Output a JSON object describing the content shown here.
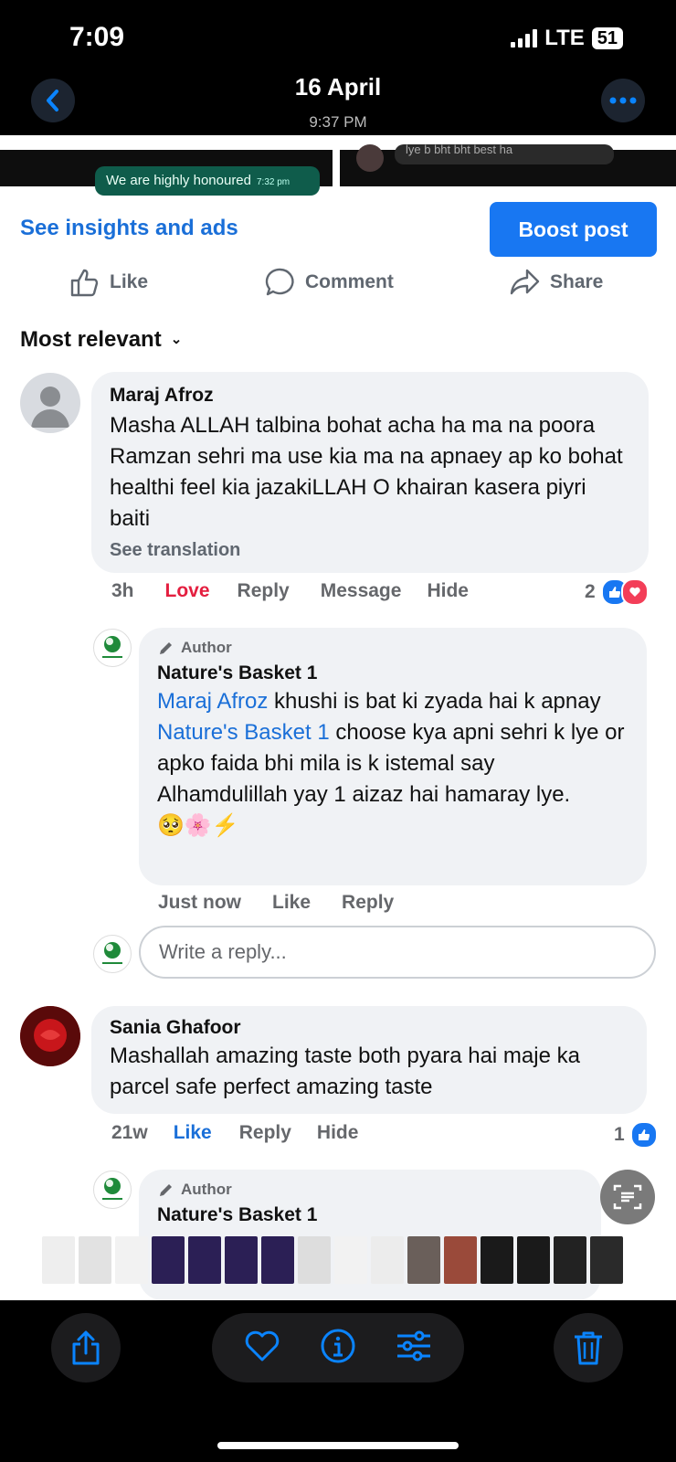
{
  "status_bar": {
    "time": "7:09",
    "network": "LTE",
    "battery": "51"
  },
  "header": {
    "date": "16 April",
    "time": "9:37 PM"
  },
  "preview": {
    "message": "We are highly honoured",
    "message_time": "7:32 pm",
    "other_text": "lye b bht bht best ha"
  },
  "post_actions": {
    "insights_link": "See insights and ads",
    "boost_button": "Boost post",
    "like": "Like",
    "comment": "Comment",
    "share": "Share"
  },
  "sort": {
    "label": "Most relevant"
  },
  "comments": [
    {
      "name": "Maraj Afroz",
      "text": "Masha ALLAH talbina bohat acha ha ma na poora Ramzan sehri ma use kia ma na apnaey ap ko bohat healthi feel kia jazakiLLAH O khairan kasera piyri baiti",
      "see_translation": "See translation",
      "time": "3h",
      "reaction_label": "Love",
      "reply": "Reply",
      "message": "Message",
      "hide": "Hide",
      "reaction_count": "2"
    },
    {
      "author_tag": "Author",
      "name": "Nature's Basket 1",
      "mention1": "Maraj Afroz",
      "text1": " khushi is bat ki zyada hai k apnay ",
      "mention2": "Nature's Basket 1",
      "text2": " choose kya apni sehri k lye or apko faida bhi mila is k istemal say Alhamdulillah yay 1 aizaz hai hamaray lye.",
      "emojis": "🥺🌸⚡",
      "time": "Just now",
      "like": "Like",
      "reply": "Reply"
    },
    {
      "name": "Sania Ghafoor",
      "text": "Mashallah amazing taste both pyara hai maje ka parcel safe perfect amazing taste",
      "time": "21w",
      "like": "Like",
      "reply": "Reply",
      "hide": "Hide",
      "reaction_count": "1"
    },
    {
      "author_tag": "Author",
      "name": "Nature's Basket 1"
    }
  ],
  "reply_input": {
    "placeholder": "Write a reply..."
  },
  "icons": [
    "back-icon",
    "more-icon",
    "like-icon",
    "comment-icon",
    "share-icon",
    "share-export-icon",
    "heart-icon",
    "info-icon",
    "adjust-icon",
    "trash-icon",
    "live-text-icon",
    "pencil-icon"
  ],
  "colors": {
    "accent": "#1877f2",
    "link": "#1a6fd8",
    "love": "#e41e3f",
    "ios_blue": "#0a84ff"
  }
}
